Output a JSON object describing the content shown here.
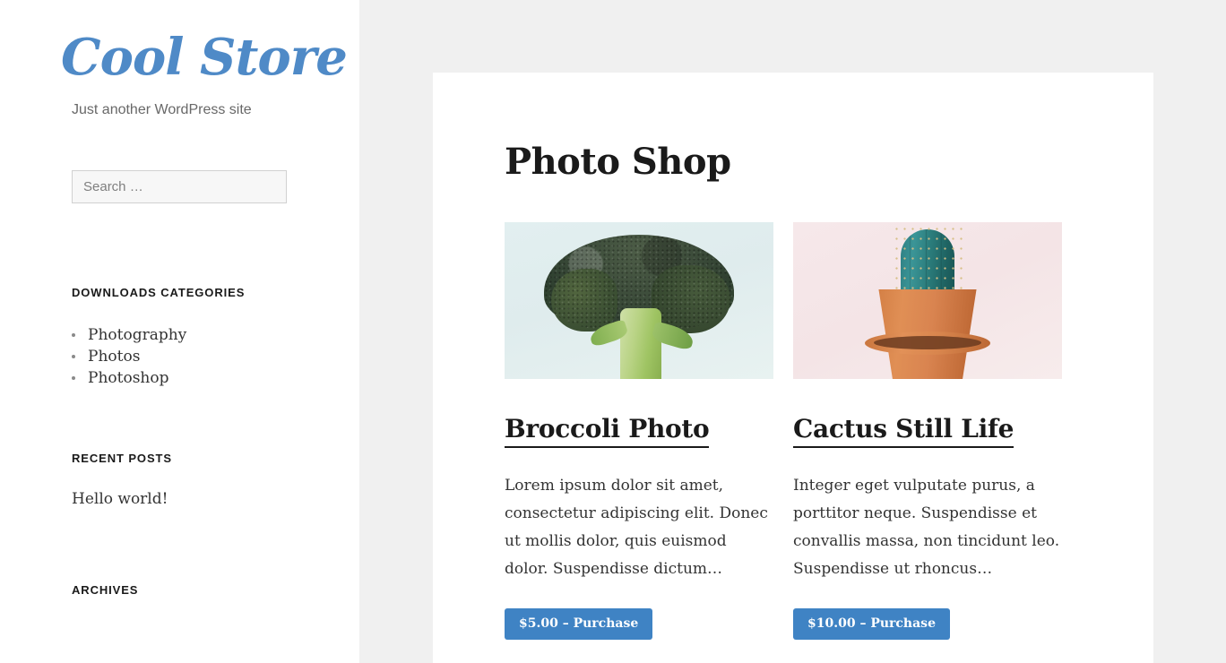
{
  "site": {
    "title": "Cool Store",
    "description": "Just another WordPress site",
    "title_color": "#4f8ac7"
  },
  "sidebar": {
    "search": {
      "placeholder": "Search …",
      "value": ""
    },
    "widgets": [
      {
        "title": "DOWNLOADS CATEGORIES",
        "items": [
          "Photography",
          "Photos",
          "Photoshop"
        ]
      },
      {
        "title": "RECENT POSTS",
        "items": [
          "Hello world!"
        ]
      },
      {
        "title": "ARCHIVES",
        "items": []
      }
    ]
  },
  "main": {
    "page_title": "Photo Shop",
    "downloads": [
      {
        "title": "Broccoli Photo",
        "excerpt": "Lorem ipsum dolor sit amet, consectetur adipiscing elit. Donec ut mollis dolor, quis euismod dolor. Suspendisse dictum…",
        "price": "$5.00",
        "button_label": "$5.00 – Purchase",
        "image_alt": "broccoli-photo-thumbnail",
        "image_bg": "#e2eff0"
      },
      {
        "title": "Cactus Still Life",
        "excerpt": "Integer eget vulputate purus, a porttitor neque. Suspendisse et convallis massa, non tincidunt leo. Suspendisse ut rhoncus…",
        "price": "$10.00",
        "button_label": "$10.00 – Purchase",
        "image_alt": "cactus-still-life-thumbnail",
        "image_bg": "#f6e8ea"
      }
    ]
  },
  "theme": {
    "accent_color": "#3f83c4",
    "page_background": "#f0f0f0",
    "card_background": "#ffffff",
    "text_color": "#1a1a1a"
  }
}
